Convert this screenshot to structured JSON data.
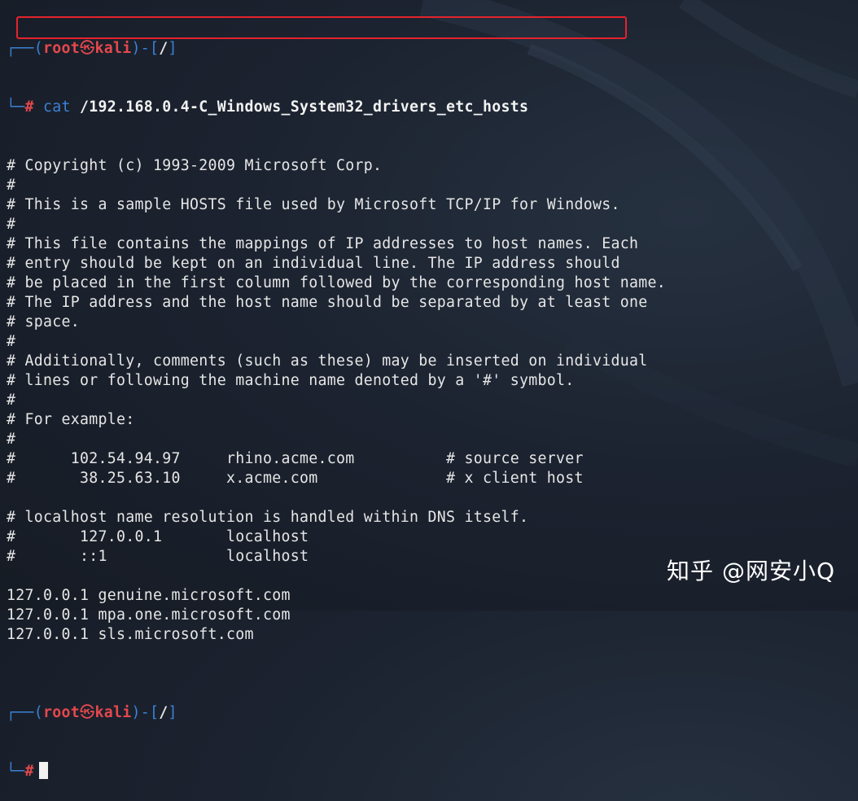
{
  "prompt": {
    "corner_top": "┌──",
    "corner_bottom": "└─",
    "open": "(",
    "user": "root",
    "skull": "㉿",
    "host": "kali",
    "close": ")-[",
    "path": "/",
    "end": "]",
    "hash": "#"
  },
  "command": {
    "name": "cat",
    "argument": "/192.168.0.4-C_Windows_System32_drivers_etc_hosts"
  },
  "output_lines": [
    "# Copyright (c) 1993-2009 Microsoft Corp.",
    "#",
    "# This is a sample HOSTS file used by Microsoft TCP/IP for Windows.",
    "#",
    "# This file contains the mappings of IP addresses to host names. Each",
    "# entry should be kept on an individual line. The IP address should",
    "# be placed in the first column followed by the corresponding host name.",
    "# The IP address and the host name should be separated by at least one",
    "# space.",
    "#",
    "# Additionally, comments (such as these) may be inserted on individual",
    "# lines or following the machine name denoted by a '#' symbol.",
    "#",
    "# For example:",
    "#",
    "#      102.54.94.97     rhino.acme.com          # source server",
    "#       38.25.63.10     x.acme.com              # x client host",
    "",
    "# localhost name resolution is handled within DNS itself.",
    "#       127.0.0.1       localhost",
    "#       ::1             localhost",
    "",
    "127.0.0.1 genuine.microsoft.com",
    "127.0.0.1 mpa.one.microsoft.com",
    "127.0.0.1 sls.microsoft.com",
    ""
  ],
  "watermark": "知乎 @网安小Q",
  "colors": {
    "background": "#1c2330",
    "prompt_blue": "#3b82d6",
    "prompt_red": "#e5484d",
    "highlight_box": "#e4232d",
    "text": "#e6e6e6"
  }
}
